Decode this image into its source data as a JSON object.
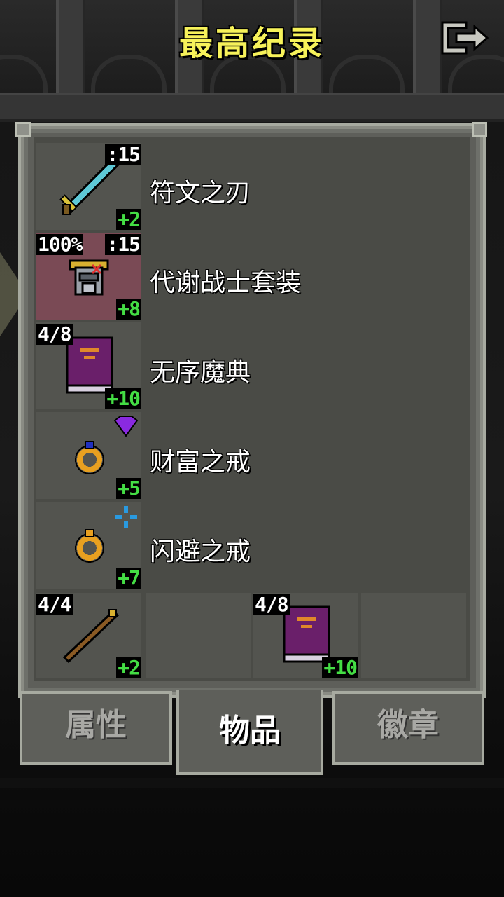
{
  "title": "最高纪录",
  "exit_button": {
    "icon": "exit-icon"
  },
  "items": [
    {
      "name": "符文之刃",
      "icon": "runic-blade-sword-icon",
      "level": ":15",
      "upgrade": "+2",
      "highlighted": false
    },
    {
      "name": "代谢战士套装",
      "icon": "warrior-armor-icon",
      "charge": "100%",
      "level": ":15",
      "upgrade": "+8",
      "highlighted": true
    },
    {
      "name": "无序魔典",
      "icon": "purple-tome-icon",
      "charges": "4/8",
      "upgrade": "+10",
      "highlighted": false
    },
    {
      "name": "财富之戒",
      "icon": "gold-ring-blue-gem-icon",
      "extra_icon": "purple-gem-icon",
      "upgrade": "+5",
      "highlighted": false
    },
    {
      "name": "闪避之戒",
      "icon": "gold-ring-orange-gem-icon",
      "extra_icon": "blue-crosshair-icon",
      "upgrade": "+7",
      "highlighted": false
    }
  ],
  "quickslots": [
    {
      "icon": "wooden-wand-icon",
      "charges": "4/4",
      "upgrade": "+2"
    },
    {
      "icon": "empty-slot"
    },
    {
      "icon": "purple-tome-icon",
      "charges": "4/8",
      "upgrade": "+10"
    },
    {
      "icon": "empty-slot"
    }
  ],
  "tabs": [
    {
      "label": "属性",
      "active": false
    },
    {
      "label": "物品",
      "active": true
    },
    {
      "label": "徽章",
      "active": false
    }
  ],
  "colors": {
    "title": "#f7f25a",
    "upgrade": "#44dd44",
    "panel": "#5e5f5a",
    "highlight": "#7a4a55"
  }
}
